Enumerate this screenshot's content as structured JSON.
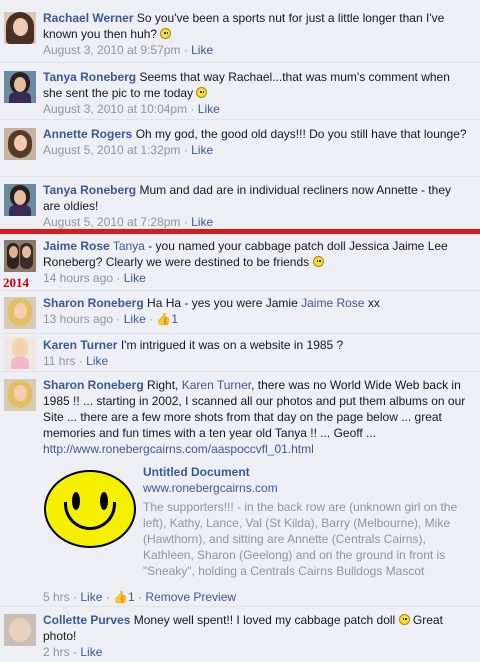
{
  "comments": [
    {
      "author": "Rachael Werner",
      "text": "So you've been a sports nut for just a little longer than I've known you then huh?",
      "time": "August 3, 2010 at 9:57pm",
      "like": "Like"
    },
    {
      "author": "Tanya Roneberg",
      "text": "Seems that way Rachael...that was mum's comment when she sent the pic to me today",
      "time": "August 3, 2010 at 10:04pm",
      "like": "Like"
    },
    {
      "author": "Annette Rogers",
      "text": "Oh my god, the good old days!!! Do you still have that lounge?",
      "time": "August 5, 2010 at 1:32pm",
      "like": "Like"
    },
    {
      "author": "Tanya Roneberg",
      "text": "Mum and dad are in individual recliners now Annette - they are oldies!",
      "time": "August 5, 2010 at 7:28pm",
      "like": "Like"
    },
    {
      "author": "Jaime Rose",
      "mention": "Tanya",
      "text": "- you named your cabbage patch doll Jessica Jaime Lee Roneberg? Clearly we were destined to be friends",
      "time": "14 hours ago",
      "like": "Like"
    },
    {
      "author": "Sharon Roneberg",
      "text": "Ha Ha - yes you were Jamie",
      "mention": "Jaime Rose",
      "suffix": "xx",
      "time": "13 hours ago",
      "like": "Like",
      "likes_count": "1"
    },
    {
      "author": "Karen Turner",
      "text": "I'm intrigued it was on a website in 1985 ?",
      "time": "11 hrs",
      "like": "Like"
    },
    {
      "author": "Sharon Roneberg",
      "text_a": "Right,",
      "mention": "Karen Turner",
      "text_b": ", there was no World Wide Web back in 1985 !! ... starting in 2002, I scanned all our photos and put them albums on our Site ... there are a few more shots from that day on the page below ... great memories and fun times with a ten year old Tanya !! ... Geoff ...",
      "url": "http://www.ronebergcairns.com/aaspoccvfl_01.html",
      "time": "5 hrs",
      "like": "Like",
      "likes_count": "1",
      "remove_preview": "Remove Preview"
    },
    {
      "author": "Collette Purves",
      "text": "Money well spent!! I loved my cabbage patch doll",
      "text_end": "Great photo!",
      "time": "2 hrs",
      "like": "Like"
    }
  ],
  "preview": {
    "title": "Untitled Document",
    "url": "www.ronebergcairns.com",
    "description": "The supporters!!! - in the back row are (unknown girl on the left), Kathy, Lance, Val (St Kilda), Barry (Melbourne), Mike (Hawthorn), and sitting are Annette (Centrals Cairns), Kathleen, Sharon (Geelong) and on the ground in front is \"Sneaky\", holding a Centrals Cairns Bulldogs Mascot"
  },
  "year_label": "2014",
  "icons": {
    "smiley": "smiley-emoticon-icon",
    "thumb": "thumbs-up-icon"
  },
  "colors": {
    "link": "#3b5998",
    "divider": "#d91a1a",
    "background": "#edeff4",
    "year": "#cc0000"
  }
}
